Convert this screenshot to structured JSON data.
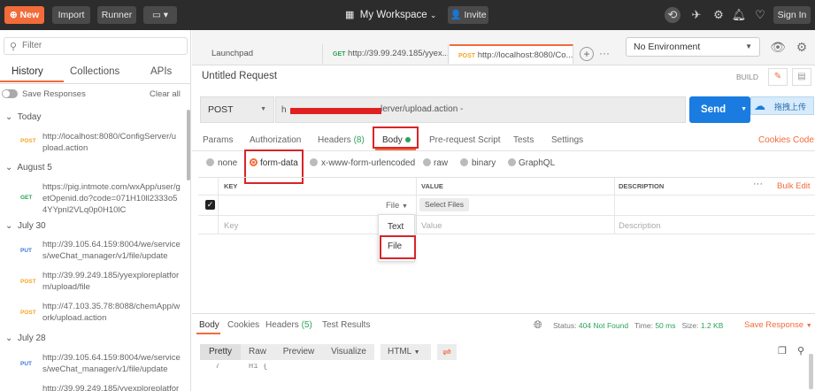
{
  "topbar": {
    "new": "New",
    "import": "Import",
    "runner": "Runner",
    "workspace": "My Workspace",
    "invite": "Invite",
    "sign_in": "Sign In"
  },
  "sidebar": {
    "filter_placeholder": "Filter",
    "tabs": [
      "History",
      "Collections",
      "APIs"
    ],
    "save_responses": "Save Responses",
    "clear_all": "Clear all",
    "groups": [
      {
        "label": "Today",
        "items": [
          {
            "method": "POST",
            "url": "http://localhost:8080/ConfigServer/upload.action"
          }
        ]
      },
      {
        "label": "August 5",
        "items": [
          {
            "method": "GET",
            "url": "https://pig.intmote.com/wxApp/user/getOpenid.do?code=071H10ll2333o54YYpnl2VLq0p0H10lC"
          }
        ]
      },
      {
        "label": "July 30",
        "items": [
          {
            "method": "PUT",
            "url": "http://39.105.64.159:8004/we/services/weChat_manager/v1/file/update"
          },
          {
            "method": "POST",
            "url": "http://39.99.249.185/yyexploreplatform/upload/file"
          },
          {
            "method": "POST",
            "url": "http://47.103.35.78:8088/chemApp/work/upload.action"
          }
        ]
      },
      {
        "label": "July 28",
        "items": [
          {
            "method": "PUT",
            "url": "http://39.105.64.159:8004/we/services/weChat_manager/v1/file/update"
          },
          {
            "method": "POST",
            "url": "http://39.99.249.185/yyexploreplatfor"
          }
        ]
      }
    ]
  },
  "tabs": [
    {
      "label": "Launchpad"
    },
    {
      "method": "GET",
      "label": "http://39.99.249.185/yyex..."
    },
    {
      "method": "POST",
      "label": "http://localhost:8080/Co..."
    }
  ],
  "environment": "No Environment",
  "request": {
    "title": "Untitled Request",
    "build": "BUILD",
    "method": "POST",
    "url_suffix": "lerver/upload.action -",
    "send": "Send",
    "floating_label": "拖拽上传"
  },
  "param_tabs": {
    "params": "Params",
    "authorization": "Authorization",
    "headers": "Headers",
    "headers_count": "(8)",
    "body": "Body",
    "pre_request": "Pre-request Script",
    "tests": "Tests",
    "settings": "Settings",
    "cookies": "Cookies",
    "code": "Code"
  },
  "body_types": [
    "none",
    "form-data",
    "x-www-form-urlencoded",
    "raw",
    "binary",
    "GraphQL"
  ],
  "form": {
    "key_header": "KEY",
    "value_header": "VALUE",
    "description_header": "DESCRIPTION",
    "bulk_edit": "Bulk Edit",
    "type_selected": "File",
    "select_files": "Select Files",
    "key_placeholder": "Key",
    "value_placeholder": "Value",
    "description_placeholder": "Description",
    "dropdown": [
      "Text",
      "File"
    ]
  },
  "response": {
    "body": "Body",
    "cookies": "Cookies",
    "headers": "Headers",
    "headers_count": "(5)",
    "test_results": "Test Results",
    "status_label": "Status:",
    "status": "404 Not Found",
    "time_label": "Time:",
    "time": "50 ms",
    "size_label": "Size:",
    "size": "1.2 KB",
    "save_response": "Save Response",
    "views": [
      "Pretty",
      "Raw",
      "Preview",
      "Visualize"
    ],
    "format": "HTML",
    "line_number": "7",
    "line_text": "H1 {"
  },
  "colors": {
    "accent": "#f26b3a",
    "send": "#1a7ce0",
    "redbox": "#d9242a",
    "status_ok": "#2aa35a"
  }
}
